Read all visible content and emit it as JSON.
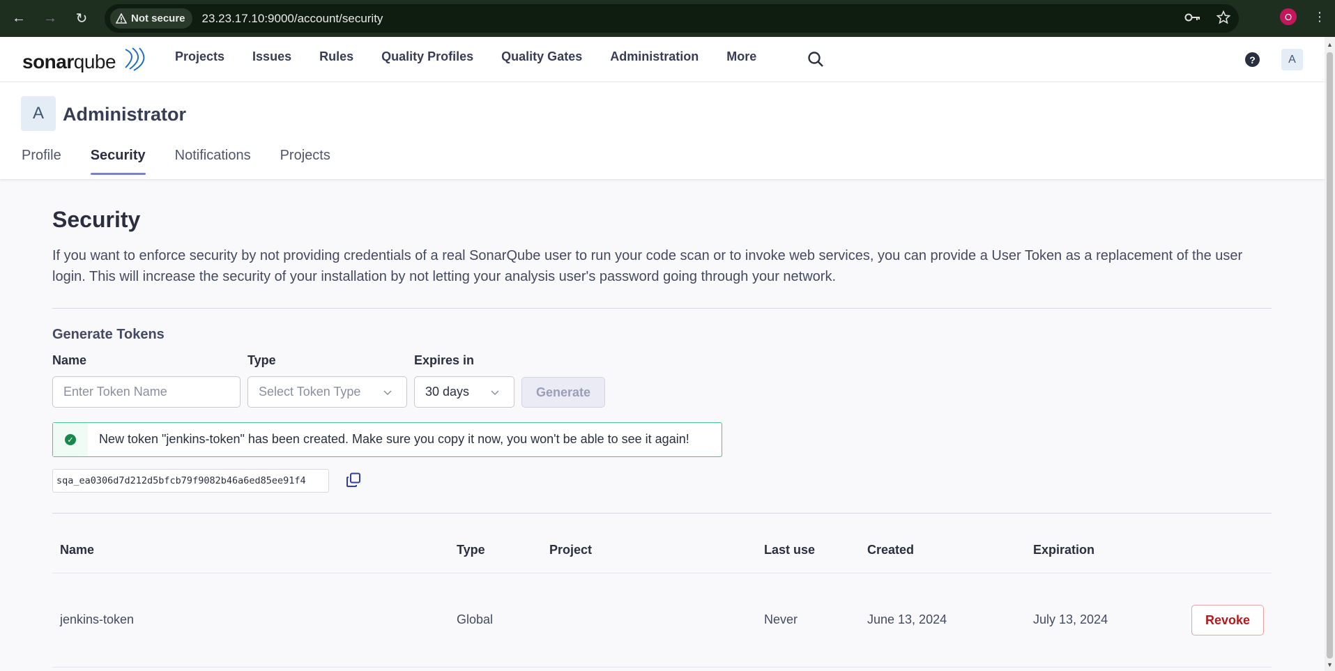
{
  "browser": {
    "security_chip": "Not secure",
    "url": "23.23.17.10:9000/account/security",
    "profile_initial": "O"
  },
  "header": {
    "logo_part1": "sonar",
    "logo_part2": "qube",
    "nav": [
      "Projects",
      "Issues",
      "Rules",
      "Quality Profiles",
      "Quality Gates",
      "Administration",
      "More"
    ],
    "help_glyph": "?",
    "avatar_initial": "A"
  },
  "account": {
    "avatar_initial": "A",
    "name": "Administrator",
    "tabs": [
      "Profile",
      "Security",
      "Notifications",
      "Projects"
    ],
    "active_tab": "Security"
  },
  "security": {
    "title": "Security",
    "intro": "If you want to enforce security by not providing credentials of a real SonarQube user to run your code scan or to invoke web services, you can provide a User Token as a replacement of the user login. This will increase the security of your installation by not letting your analysis user's password going through your network.",
    "generate": {
      "title": "Generate Tokens",
      "name_label": "Name",
      "name_placeholder": "Enter Token Name",
      "type_label": "Type",
      "type_placeholder": "Select Token Type",
      "expires_label": "Expires in",
      "expires_value": "30 days",
      "button": "Generate"
    },
    "success_message": "New token \"jenkins-token\" has been created. Make sure you copy it now, you won't be able to see it again!",
    "token_value": "sqa_ea0306d7d212d5bfcb79f9082b46a6ed85ee91f4",
    "table": {
      "headers": [
        "Name",
        "Type",
        "Project",
        "Last use",
        "Created",
        "Expiration"
      ],
      "rows": [
        {
          "name": "jenkins-token",
          "type": "Global",
          "project": "",
          "last_use": "Never",
          "created": "June 13, 2024",
          "expiration": "July 13, 2024",
          "action": "Revoke"
        }
      ]
    }
  }
}
